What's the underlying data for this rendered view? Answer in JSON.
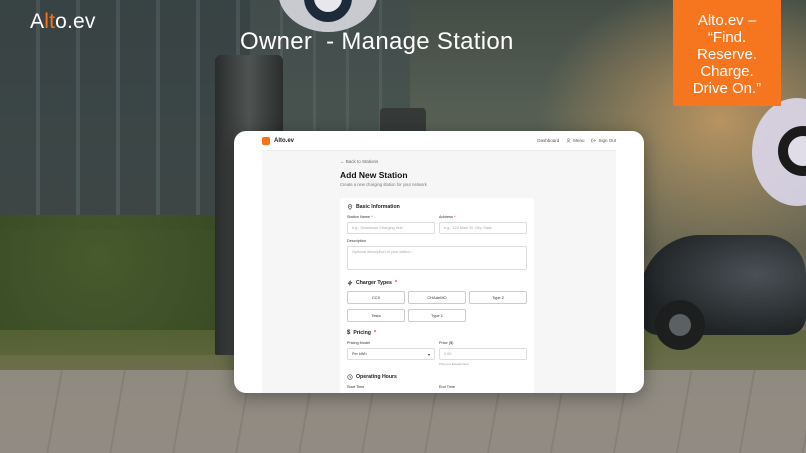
{
  "brand": {
    "prefix": "A",
    "accent": "lt",
    "suffix": "o.ev",
    "accent_color": "#f97316"
  },
  "slide": {
    "title": "Owner  - Manage Station",
    "tagline": [
      "Alto.ev –",
      "“Find.",
      "Reserve.",
      "Charge.",
      "Drive On.”"
    ]
  },
  "app": {
    "brand": "Alto.ev",
    "nav": {
      "dashboard": "Dashboard",
      "menu": "Menu",
      "signout": "Sign Out"
    },
    "back_link": "Back to Stations",
    "page_title": "Add New Station",
    "page_subtitle": "Create a new charging station for your network",
    "basic": {
      "title": "Basic Information",
      "station_name_label": "Station Name",
      "station_name_placeholder": "e.g., Downtown Charging Hub",
      "address_label": "Address",
      "address_placeholder": "e.g., 123 Main St, City, State",
      "description_label": "Description",
      "description_placeholder": "Optional description of your station..."
    },
    "chargers": {
      "title": "Charger Types",
      "options": [
        "CCS",
        "CHAdeMO",
        "Type 2",
        "Tesla",
        "Type 1"
      ]
    },
    "pricing": {
      "title": "Pricing",
      "model_label": "Pricing Model",
      "model_value": "Per kWh",
      "price_label": "Price ($)",
      "price_placeholder": "0.00",
      "price_hint": "Price per kilowatt-hour"
    },
    "hours": {
      "title": "Operating Hours",
      "start_label": "Start Time",
      "end_label": "End Time"
    }
  }
}
